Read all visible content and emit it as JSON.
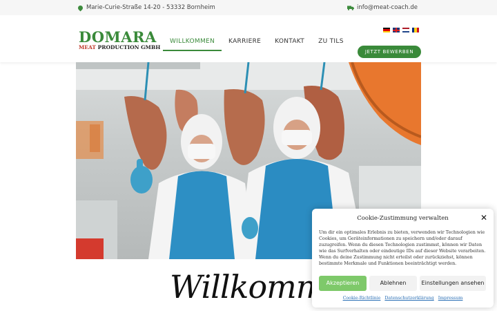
{
  "topbar": {
    "address": "Marie-Curie-Straße 14-20 - 53332 Bornheim",
    "email": "info@meat-coach.de",
    "pin_icon": "location-pin-icon",
    "truck_icon": "truck-icon"
  },
  "logo": {
    "main": "DOMARA",
    "sub_red": "MEAT",
    "sub_dark": "PRODUCTION GMBH"
  },
  "nav": {
    "items": [
      {
        "label": "WILLKOMMEN",
        "active": true
      },
      {
        "label": "KARRIERE"
      },
      {
        "label": "KONTAKT"
      },
      {
        "label": "ZU TILS"
      }
    ]
  },
  "languages": [
    "de",
    "en",
    "nl",
    "ro"
  ],
  "cta": {
    "label": "JETZT BEWERBEN"
  },
  "hero": {
    "alt": ""
  },
  "welcome": {
    "text": "Willkommen"
  },
  "cookie": {
    "title": "Cookie-Zustimmung verwalten",
    "text": "Um dir ein optimales Erlebnis zu bieten, verwenden wir Technologien wie Cookies, um Geräteinformationen zu speichern und/oder darauf zuzugreifen. Wenn du diesen Technologien zustimmst, können wir Daten wie das Surfverhalten oder eindeutige IDs auf dieser Website verarbeiten. Wenn du deine Zustimmung nicht erteilst oder zurückziehst, können bestimmte Merkmale und Funktionen beeinträchtigt werden.",
    "accept": "Akzeptieren",
    "decline": "Ablehnen",
    "settings": "Einstellungen ansehen",
    "links": [
      "Cookie-Richtlinie",
      "Datenschutzerklärung",
      "Impressum"
    ]
  },
  "colors": {
    "brand_green": "#3a8a3a",
    "accept_green": "#7ec96a",
    "logo_red": "#c0392b",
    "link_blue": "#2a6fb5"
  }
}
